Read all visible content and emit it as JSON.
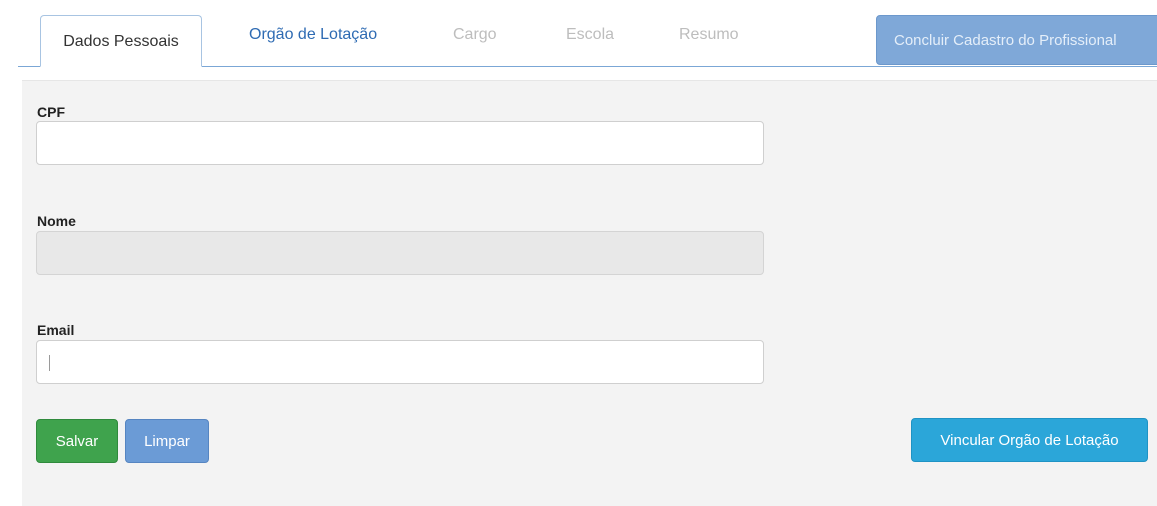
{
  "tabs": {
    "dados_pessoais": "Dados Pessoais",
    "orgao_lotacao": "Orgão de Lotação",
    "cargo": "Cargo",
    "escola": "Escola",
    "resumo": "Resumo"
  },
  "header": {
    "finish_button": "Concluir Cadastro do Profissional"
  },
  "form": {
    "cpf_label": "CPF",
    "cpf_value": "",
    "nome_label": "Nome",
    "nome_value": "",
    "email_label": "Email",
    "email_value": ""
  },
  "actions": {
    "save": "Salvar",
    "clear": "Limpar",
    "link_org": "Vincular Orgão de Lotação"
  },
  "colors": {
    "save": "#3fa34d",
    "clear": "#6b9bd6",
    "link_org": "#2ba6d9",
    "finish": "#7fa8d8",
    "tab_link": "#2e6bb3"
  }
}
